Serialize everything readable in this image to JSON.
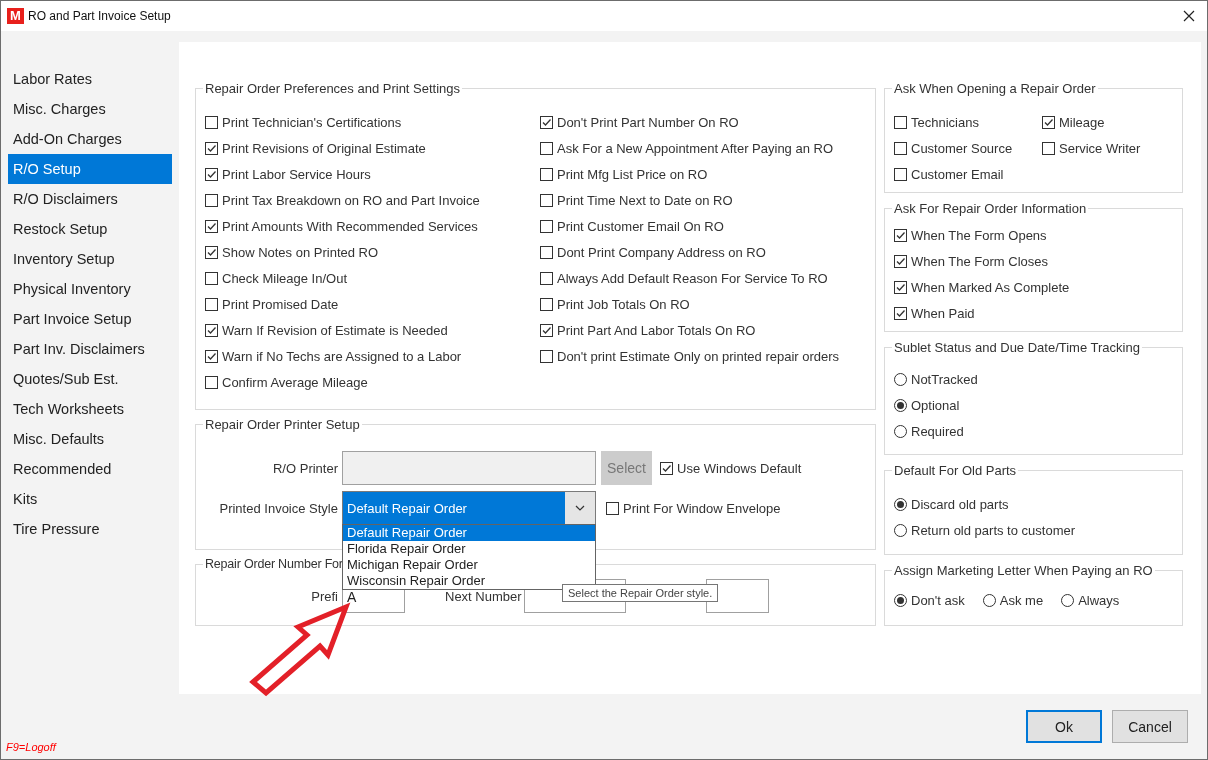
{
  "window": {
    "logo": "M",
    "title": "RO and Part Invoice Setup"
  },
  "sidebar": {
    "items": [
      {
        "label": "Labor Rates",
        "selected": false
      },
      {
        "label": "Misc. Charges",
        "selected": false
      },
      {
        "label": "Add-On Charges",
        "selected": false
      },
      {
        "label": "R/O Setup",
        "selected": true
      },
      {
        "label": "R/O Disclaimers",
        "selected": false
      },
      {
        "label": "Restock Setup",
        "selected": false
      },
      {
        "label": "Inventory Setup",
        "selected": false
      },
      {
        "label": "Physical Inventory",
        "selected": false
      },
      {
        "label": "Part Invoice Setup",
        "selected": false
      },
      {
        "label": "Part Inv. Disclaimers",
        "selected": false
      },
      {
        "label": "Quotes/Sub Est.",
        "selected": false
      },
      {
        "label": "Tech Worksheets",
        "selected": false
      },
      {
        "label": "Misc. Defaults",
        "selected": false
      },
      {
        "label": "Recommended",
        "selected": false
      },
      {
        "label": "Kits",
        "selected": false
      },
      {
        "label": "Tire Pressure",
        "selected": false
      }
    ]
  },
  "preferences": {
    "title": "Repair Order Preferences and Print Settings",
    "columns": [
      [
        {
          "label": "Print Technician's Certifications",
          "checked": false
        },
        {
          "label": "Print Revisions of Original Estimate",
          "checked": true
        },
        {
          "label": "Print Labor Service Hours",
          "checked": true
        },
        {
          "label": "Print Tax Breakdown on RO and Part Invoice",
          "checked": false
        },
        {
          "label": "Print Amounts With Recommended Services",
          "checked": true
        },
        {
          "label": "Show Notes on Printed RO",
          "checked": true
        },
        {
          "label": "Check Mileage In/Out",
          "checked": false
        },
        {
          "label": "Print Promised Date",
          "checked": false
        },
        {
          "label": "Warn If Revision of Estimate is Needed",
          "checked": true
        },
        {
          "label": "Warn if No Techs are Assigned to a Labor",
          "checked": true
        },
        {
          "label": "Confirm Average Mileage",
          "checked": false
        }
      ],
      [
        {
          "label": "Don't Print Part Number On RO",
          "checked": true
        },
        {
          "label": "Ask For a New Appointment After Paying an RO",
          "checked": false
        },
        {
          "label": "Print Mfg List Price on RO",
          "checked": false
        },
        {
          "label": "Print Time Next to Date on RO",
          "checked": false
        },
        {
          "label": "Print Customer Email On RO",
          "checked": false
        },
        {
          "label": "Dont Print Company Address on RO",
          "checked": false
        },
        {
          "label": "Always Add Default Reason For Service To RO",
          "checked": false
        },
        {
          "label": "Print Job Totals On RO",
          "checked": false
        },
        {
          "label": "Print Part And Labor Totals On RO",
          "checked": true
        },
        {
          "label": "Don't print Estimate Only on printed repair orders",
          "checked": false
        }
      ]
    ]
  },
  "printer_setup": {
    "title": "Repair Order Printer Setup",
    "printer_label": "R/O Printer",
    "select_button": {
      "label": "Select",
      "disabled": true
    },
    "use_windows_default": {
      "label": "Use Windows Default",
      "checked": true
    },
    "style_label": "Printed Invoice Style",
    "style_value": "Default Repair Order",
    "style_options": [
      {
        "label": "Default Repair Order",
        "selected": true
      },
      {
        "label": "Florida Repair Order",
        "selected": false
      },
      {
        "label": "Michigan Repair Order",
        "selected": false
      },
      {
        "label": "Wisconsin Repair Order",
        "selected": false
      }
    ],
    "tooltip": "Select the Repair Order style.",
    "window_envelope": {
      "label": "Print For Window Envelope",
      "checked": false
    }
  },
  "number_format": {
    "title": "Repair Order Number For",
    "prefix_label": "Prefi",
    "prefix_value": "A",
    "next_label": "Next Number"
  },
  "ask_when_opening": {
    "title": "Ask When Opening a Repair Order",
    "items": [
      {
        "label": "Technicians",
        "checked": false
      },
      {
        "label": "Mileage",
        "checked": true
      },
      {
        "label": "Customer Source",
        "checked": false
      },
      {
        "label": "Service Writer",
        "checked": false
      },
      {
        "label": "Customer Email",
        "checked": false
      }
    ]
  },
  "ask_for_info": {
    "title": "Ask For Repair Order Information",
    "items": [
      {
        "label": "When The Form Opens",
        "checked": true
      },
      {
        "label": "When The Form Closes",
        "checked": true
      },
      {
        "label": "When Marked As Complete",
        "checked": true
      },
      {
        "label": "When Paid",
        "checked": true
      }
    ]
  },
  "sublet_tracking": {
    "title": "Sublet Status and Due Date/Time Tracking",
    "options": [
      {
        "label": "NotTracked",
        "selected": false
      },
      {
        "label": "Optional",
        "selected": true
      },
      {
        "label": "Required",
        "selected": false
      }
    ]
  },
  "old_parts": {
    "title": "Default For Old Parts",
    "options": [
      {
        "label": "Discard old parts",
        "selected": true
      },
      {
        "label": "Return old parts to customer",
        "selected": false
      }
    ]
  },
  "marketing_letter": {
    "title": "Assign Marketing Letter When Paying an RO",
    "options": [
      {
        "label": "Don't ask",
        "selected": true
      },
      {
        "label": "Ask me",
        "selected": false
      },
      {
        "label": "Always",
        "selected": false
      }
    ]
  },
  "buttons": [
    {
      "label": "Ok",
      "focused": true
    },
    {
      "label": "Cancel",
      "focused": false
    }
  ],
  "footer_hint": "F9=Logoff"
}
